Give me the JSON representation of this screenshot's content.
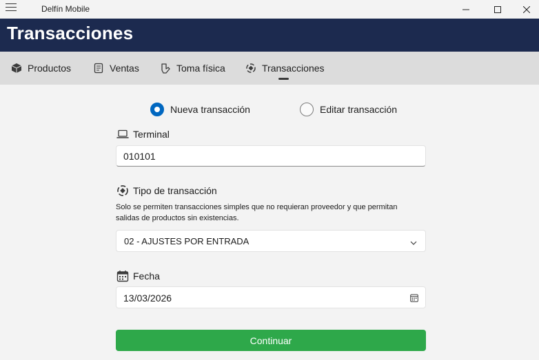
{
  "window": {
    "app_title": "Delfín Mobile"
  },
  "header": {
    "title": "Transacciones"
  },
  "tabs": [
    {
      "label": "Productos",
      "icon": "box-icon"
    },
    {
      "label": "Ventas",
      "icon": "receipt-icon"
    },
    {
      "label": "Toma física",
      "icon": "hand-scan-icon"
    },
    {
      "label": "Transacciones",
      "icon": "transfer-icon",
      "active": true
    }
  ],
  "form": {
    "mode_options": [
      {
        "label": "Nueva transacción",
        "checked": true
      },
      {
        "label": "Editar transacción",
        "checked": false
      }
    ],
    "terminal": {
      "label": "Terminal",
      "value": "010101"
    },
    "transaction_type": {
      "label": "Tipo de transacción",
      "note": "Solo se permiten transacciones simples que no requieran proveedor  y que permitan salidas de productos sin existencias.",
      "selected": "02 - AJUSTES POR ENTRADA"
    },
    "date": {
      "label": "Fecha",
      "value": "13/03/2026"
    },
    "continue_label": "Continuar"
  },
  "colors": {
    "header_bg": "#1c2a4f",
    "accent": "#0067c0",
    "continue_bg": "#2ea84a",
    "tabs_bg": "#dcdcdc"
  }
}
